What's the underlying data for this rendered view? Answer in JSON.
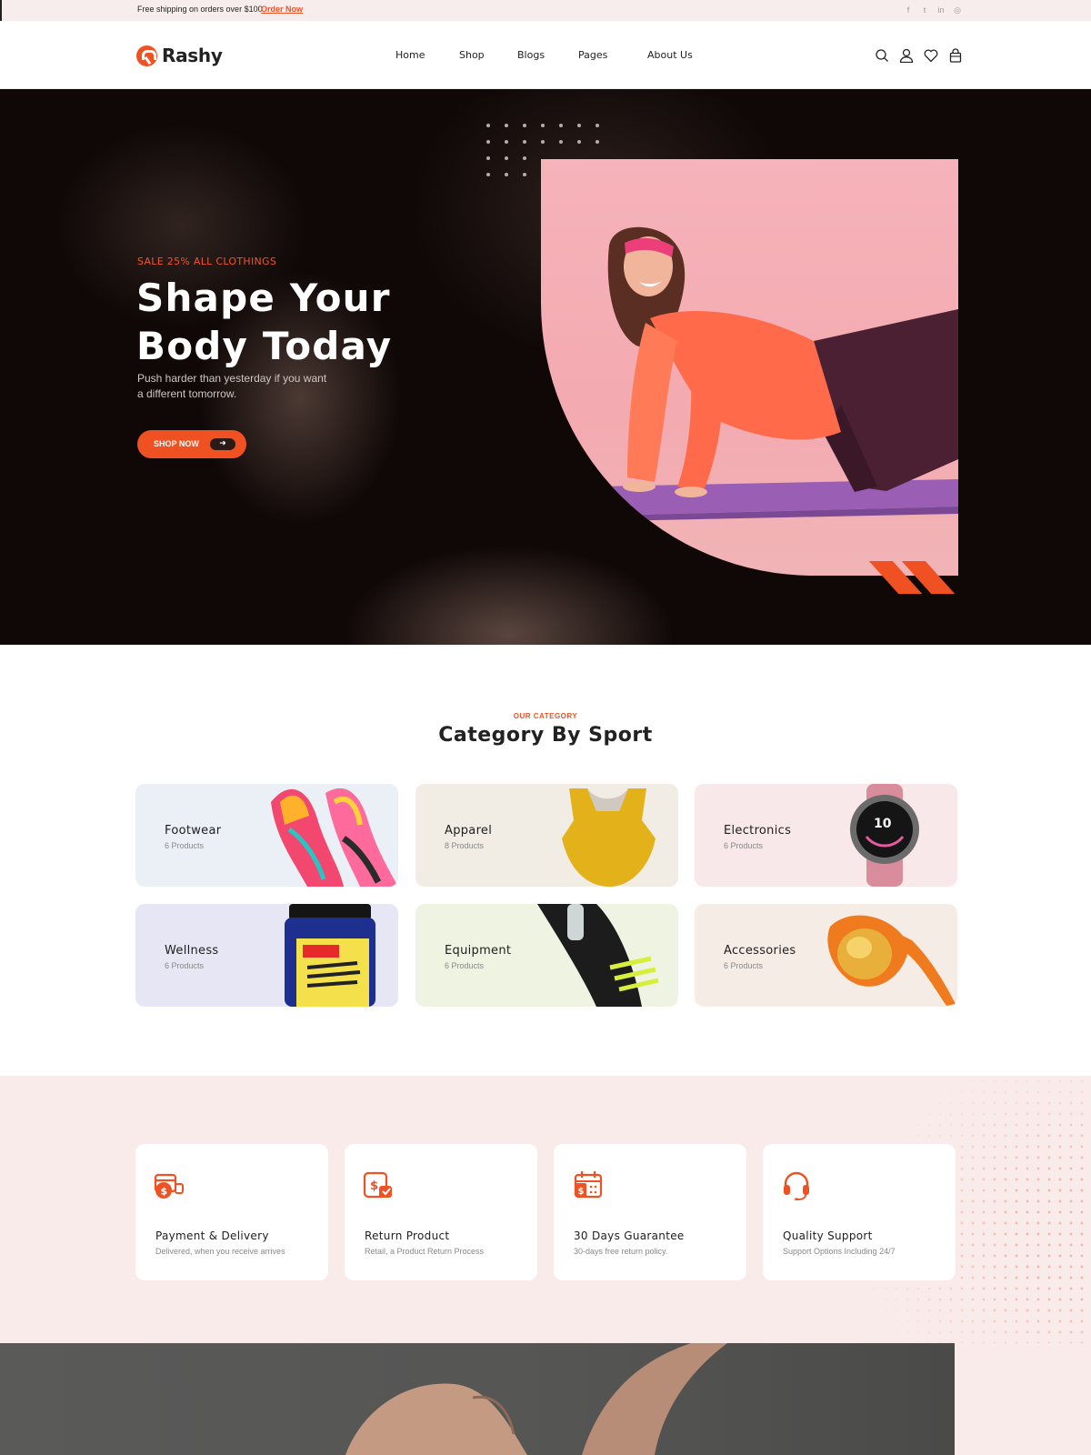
{
  "topbar": {
    "shipping_text": "Free shipping on orders over $100",
    "order_link": "Order Now",
    "social_icons": [
      "facebook-icon",
      "twitter-icon",
      "linkedin-icon",
      "instagram-icon"
    ]
  },
  "header": {
    "logo": "Rashy",
    "nav": [
      "Home",
      "Shop",
      "Blogs",
      "Pages",
      "About Us"
    ],
    "icons": [
      "search-icon",
      "user-icon",
      "heart-icon",
      "bag-icon"
    ]
  },
  "hero": {
    "tag": "SALE 25% ALL CLOTHINGS",
    "title": "Shape Your Body Today",
    "subtitle": "Push harder than yesterday if you want a different tomorrow.",
    "button_label": "SHOP NOW"
  },
  "category": {
    "eyebrow": "OUR CATEGORY",
    "title": "Category By Sport",
    "items": [
      {
        "name": "Footwear",
        "count": "6 Products",
        "bg": "#eaf0f5"
      },
      {
        "name": "Apparel",
        "count": "8 Products",
        "bg": "#f1ede5"
      },
      {
        "name": "Electronics",
        "count": "6 Products",
        "bg": "#f8e8ea"
      },
      {
        "name": "Wellness",
        "count": "6 Products",
        "bg": "#e7e6f4"
      },
      {
        "name": "Equipment",
        "count": "6 Products",
        "bg": "#eef3e2"
      },
      {
        "name": "Accessories",
        "count": "6 Products",
        "bg": "#f6ece6"
      }
    ]
  },
  "features": [
    {
      "title": "Payment & Delivery",
      "desc": "Delivered, when you receive arrives",
      "icon": "payment-icon"
    },
    {
      "title": "Return Product",
      "desc": "Retail, a Product Return Process",
      "icon": "return-icon"
    },
    {
      "title": "30 Days Guarantee",
      "desc": "30-days free return policy.",
      "icon": "calendar-guarantee-icon"
    },
    {
      "title": "Quality Support",
      "desc": "Support Options Including 24/7",
      "icon": "headset-icon"
    }
  ],
  "colors": {
    "accent": "#f05123",
    "dark": "#0f0807",
    "features_bg": "#f8ebe9"
  }
}
